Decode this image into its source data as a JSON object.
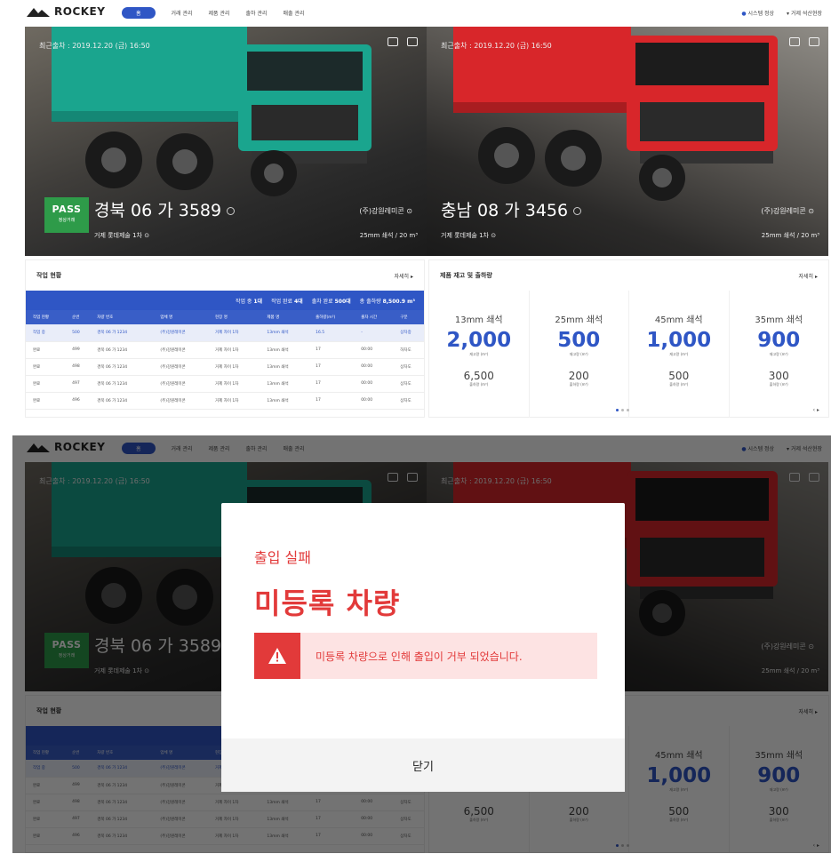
{
  "app": {
    "brand": "ROCKEY"
  },
  "nav": {
    "menu": [
      "홈",
      "거래 관리",
      "제품 관리",
      "출하 관리",
      "매출 관리"
    ],
    "active_index": 0,
    "status_label": "시스템 정상",
    "user_label": "거제 석산현장"
  },
  "cameras": [
    {
      "timestamp": "최근출차 : 2019.12.20 (금) 16:50",
      "plate": "경북 06 가 3589",
      "company": "(주)강원레미콘",
      "site": "거제 롯데제술 1차",
      "spec": "25mm 쇄석 / 20 m³",
      "pass_label": "PASS",
      "pass_sub": "정상거래",
      "truck_color": "#1aa58e"
    },
    {
      "timestamp": "최근출차 : 2019.12.20 (금) 16:50",
      "plate": "충남 08 가 3456",
      "company": "(주)강원레미콘",
      "site": "거제 롯데제술 1차",
      "spec": "25mm 쇄석 / 20 m³",
      "truck_color": "#d8262a"
    }
  ],
  "work_status": {
    "title": "작업 현황",
    "more": "자세히 ▸",
    "summary": [
      {
        "label": "작업 중",
        "value": "1대"
      },
      {
        "label": "작업 완료",
        "value": "4대"
      },
      {
        "label": "출차 완료",
        "value": "500대"
      },
      {
        "label": "총 출하량",
        "value": "8,500.9 m³"
      }
    ],
    "columns": [
      "작업 현황",
      "순번",
      "차량 번호",
      "업체 명",
      "현장 명",
      "제품 명",
      "출하량(m³)",
      "출차 시간",
      "구분"
    ],
    "rows": [
      [
        "작업 중",
        "500",
        "경북 06 가 1234",
        "(주)강원레미콘",
        "거제 자이 1차",
        "13mm 쇄석",
        "16.5",
        "-",
        "상차중"
      ],
      [
        "완료",
        "499",
        "경북 06 가 1234",
        "(주)강원레미콘",
        "거제 자이 1차",
        "13mm 쇄석",
        "17",
        "00:00",
        "하차도"
      ],
      [
        "완료",
        "498",
        "경북 06 가 1234",
        "(주)강원레미콘",
        "거제 자이 1차",
        "13mm 쇄석",
        "17",
        "00:00",
        "상차도"
      ],
      [
        "완료",
        "497",
        "경북 06 가 1234",
        "(주)강원레미콘",
        "거제 자이 1차",
        "13mm 쇄석",
        "17",
        "00:00",
        "상차도"
      ],
      [
        "완료",
        "496",
        "경북 06 가 1234",
        "(주)강원레미콘",
        "거제 자이 1차",
        "13mm 쇄석",
        "17",
        "00:00",
        "상차도"
      ]
    ]
  },
  "stock": {
    "title": "제품 재고 및 출하량",
    "more": "자세히 ▸",
    "stock_unit_label": "재고량 (m³)",
    "out_unit_label": "출하량 (m³)",
    "items": [
      {
        "name": "13mm 쇄석",
        "stock": "2,000",
        "out": "6,500"
      },
      {
        "name": "25mm 쇄석",
        "stock": "500",
        "out": "200"
      },
      {
        "name": "45mm 쇄석",
        "stock": "1,000",
        "out": "500"
      },
      {
        "name": "35mm 쇄석",
        "stock": "900",
        "out": "300"
      }
    ],
    "arrows": "‹ ▸"
  },
  "modal": {
    "title": "출입 실패",
    "headline": "미등록 차량",
    "message": "미등록 차량으로 인해 출입이 거부 되었습니다.",
    "close_label": "닫기"
  },
  "colors": {
    "accent": "#2f56c5",
    "danger": "#e23a3a",
    "pass": "#2e9b49"
  }
}
